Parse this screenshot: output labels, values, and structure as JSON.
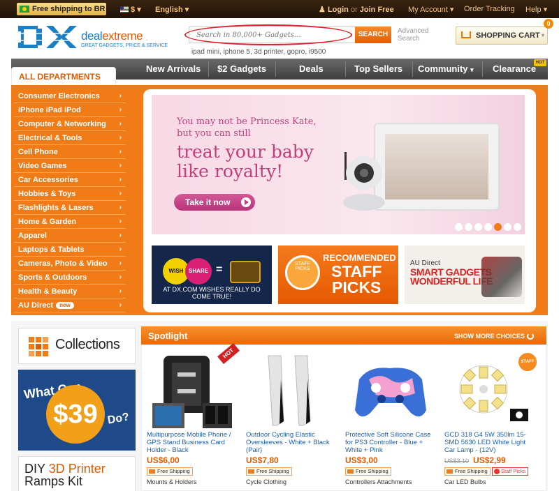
{
  "topbar": {
    "shipping": "Free shipping to BR",
    "currency": "$",
    "language": "English",
    "login": "Login",
    "or": "or",
    "join": "Join Free",
    "account": "My Account",
    "tracking": "Order Tracking",
    "help": "Help"
  },
  "header": {
    "logo_mark": "DX",
    "logo_brand_a": "deal",
    "logo_brand_b": "extreme",
    "logo_tagline": "GREAT GADGETS, PRICE & SERVICE",
    "search_placeholder": "Search in 80,000+ Gadgets...",
    "search_button": "SEARCH",
    "advanced_search": "Advanced Search",
    "hints": "ipad mini, iphone 5, 3d printer, gopro, i9500",
    "cart_label": "SHOPPING CART",
    "cart_count": "0"
  },
  "nav": {
    "all_departments": "ALL DEPARTMENTS",
    "items": [
      "New Arrivals",
      "$2 Gadgets",
      "Deals",
      "Top Sellers",
      "Community",
      "Clearance"
    ],
    "hot_badge": "HOT"
  },
  "sidebar": {
    "items": [
      "Consumer Electronics",
      "iPhone iPad iPod",
      "Computer & Networking",
      "Electrical & Tools",
      "Cell Phone",
      "Video Games",
      "Car Accessories",
      "Hobbies & Toys",
      "Flashlights & Lasers",
      "Home & Garden",
      "Apparel",
      "Laptops & Tablets",
      "Cameras, Photo & Video",
      "Sports & Outdoors",
      "Health & Beauty",
      "AU Direct"
    ],
    "new_badge": "new"
  },
  "banner": {
    "line1": "You may not be Princess Kate,",
    "line2": "but you can still",
    "line3": "treat your baby",
    "line4": "like royalty!",
    "cta": "Take it now",
    "slide_count": 7,
    "active_slide": 5
  },
  "promos": {
    "wish": "WISH",
    "share": "SHARE",
    "wish_text": "AT DX.COM WISHES REALLY DO COME TRUE!",
    "recommended": "RECOMMENDED",
    "staff": "STAFF",
    "picks": "PICKS",
    "staff_badge": "STAFF PICKS",
    "au_direct": "AU Direct",
    "smart": "SMART GADGETS",
    "wonderful": "WONDERFUL LIFE"
  },
  "left": {
    "collections": "Collections",
    "what": "What Can",
    "price39": "$39",
    "do": "Do?",
    "diy_a": "DIY ",
    "diy_b": "3D Printer",
    "ramps": "Ramps Kit"
  },
  "spotlight": {
    "title": "Spotlight",
    "more": "SHOW MORE CHOICES",
    "products": [
      {
        "name": "Multipurpose Mobile Phone / GPS Stand Business Card Holder - Black",
        "price": "US$6,00",
        "old": "",
        "shipping": "Free Shipping",
        "category": "Mounts & Holders",
        "tag": "HOT"
      },
      {
        "name": "Outdoor Cycling Elastic Oversleeves - White + Black (Pair)",
        "price": "US$7,80",
        "old": "",
        "shipping": "Free Shipping",
        "category": "Cycle Clothing",
        "tag": ""
      },
      {
        "name": "Protective Soft Silicone Case for PS3 Controller - Blue + White + Pink",
        "price": "US$3,00",
        "old": "",
        "shipping": "Free Shipping",
        "category": "Controllers Attachments",
        "tag": ""
      },
      {
        "name": "GCD 318 G4 5W 350lm 15-SMD 5630 LED White Light Car Lamp - (12V)",
        "price": "US$2,99",
        "old": "US$3,10",
        "shipping": "Free Shipping",
        "category": "Car LED Bulbs",
        "tag": "STAFF PICKS",
        "staff": "Staff Picks"
      }
    ]
  },
  "colors": {
    "accent": "#f07b17",
    "nav": "#4a4a4a",
    "link": "#1a5fb4"
  }
}
